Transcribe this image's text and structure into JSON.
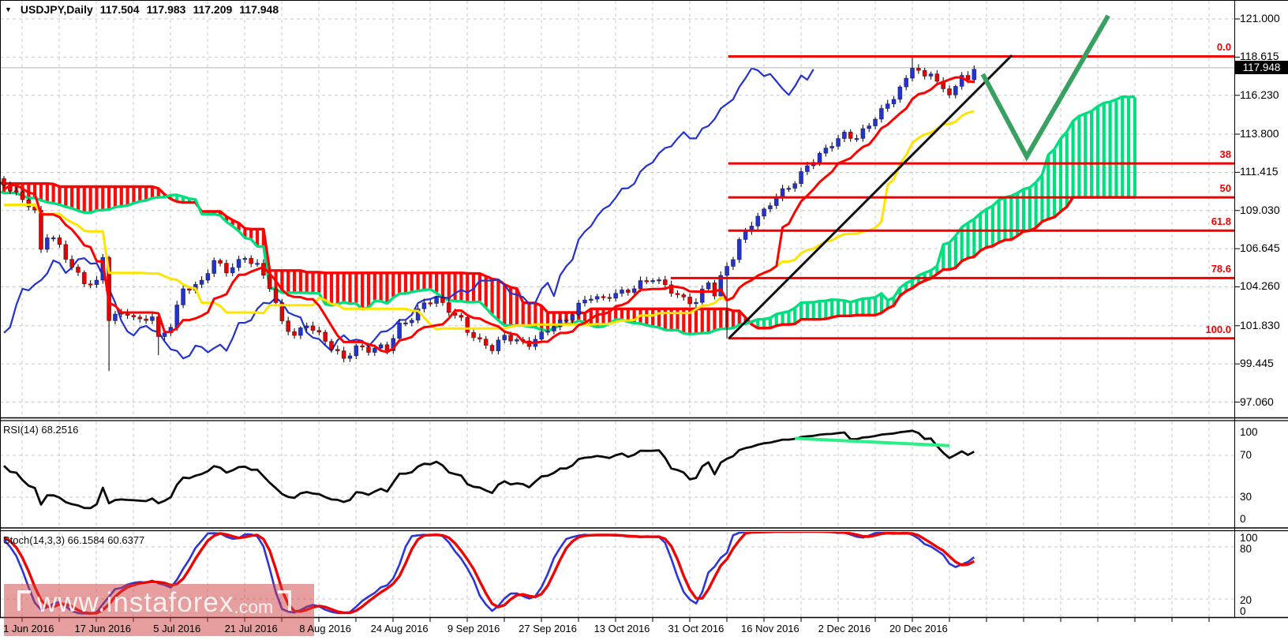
{
  "title": {
    "indicator_arrow": "▼",
    "symbol_period": "USDJPY,Daily",
    "open": "117.504",
    "high": "117.983",
    "low": "117.209",
    "close": "117.948"
  },
  "price_axis": {
    "ticks": [
      "121.000",
      "118.615",
      "116.230",
      "113.800",
      "111.415",
      "109.030",
      "106.645",
      "104.260",
      "101.830",
      "99.445",
      "97.060"
    ],
    "current_price": "117.948"
  },
  "rsi_pane": {
    "label": "RSI(14)",
    "value": "68.2516",
    "ticks": [
      "100",
      "70",
      "30",
      "0"
    ]
  },
  "stoch_pane": {
    "label": "Stoch(14,3,3)",
    "value_k": "66.1584",
    "value_d": "60.6377",
    "ticks": [
      "100",
      "80",
      "20",
      "0"
    ]
  },
  "date_axis": {
    "labels": [
      "1 Jun 2016",
      "17 Jun 2016",
      "5 Jul 2016",
      "21 Jul 2016",
      "8 Aug 2016",
      "24 Aug 2016",
      "9 Sep 2016",
      "27 Sep 2016",
      "13 Oct 2016",
      "31 Oct 2016",
      "16 Nov 2016",
      "2 Dec 2016",
      "20 Dec 2016"
    ],
    "first_index": 4,
    "index_step": 12
  },
  "watermark": {
    "text": "www.instaforex",
    "suffix": ".com"
  },
  "chart_data": {
    "type": "candlestick",
    "symbol": "USDJPY",
    "timeframe": "Daily",
    "ylim": [
      96.0,
      122.2
    ],
    "grid": true,
    "indicators": {
      "ichimoku": [
        9,
        26,
        52
      ],
      "rsi": [
        14
      ],
      "stochastic": [
        14,
        3,
        3
      ]
    },
    "current_price": 117.948,
    "close_points": [
      [
        -80,
        113.8
      ],
      [
        -75,
        112.5
      ],
      [
        -70,
        113.5
      ],
      [
        -66,
        112.0
      ],
      [
        -62,
        111.0
      ],
      [
        -58,
        112.8
      ],
      [
        -54,
        113.3
      ],
      [
        -50,
        111.5
      ],
      [
        -46,
        109.8
      ],
      [
        -42,
        108.0
      ],
      [
        -38,
        107.9
      ],
      [
        -34,
        109.5
      ],
      [
        -30,
        111.2
      ],
      [
        -26,
        110.8
      ],
      [
        -22,
        109.0
      ],
      [
        -18,
        107.6
      ],
      [
        -14,
        108.2
      ],
      [
        -10,
        109.4
      ],
      [
        -6,
        110.6
      ],
      [
        -3,
        111.1
      ],
      [
        0,
        110.6
      ],
      [
        2,
        110.1
      ],
      [
        4,
        109.5
      ],
      [
        5,
        109.0
      ],
      [
        6,
        106.5
      ],
      [
        7,
        107.4
      ],
      [
        8,
        107.2
      ],
      [
        9,
        106.7
      ],
      [
        10,
        106.1
      ],
      [
        12,
        105.1
      ],
      [
        13,
        104.6
      ],
      [
        15,
        104.5
      ],
      [
        16,
        106.0
      ],
      [
        17,
        102.2
      ],
      [
        18,
        102.4
      ],
      [
        20,
        102.7
      ],
      [
        22,
        102.2
      ],
      [
        24,
        102.4
      ],
      [
        25,
        100.9
      ],
      [
        27,
        101.8
      ],
      [
        28,
        103.0
      ],
      [
        29,
        104.2
      ],
      [
        31,
        104.4
      ],
      [
        32,
        104.6
      ],
      [
        34,
        105.8
      ],
      [
        36,
        105.2
      ],
      [
        38,
        105.9
      ],
      [
        39,
        106.2
      ],
      [
        41,
        105.6
      ],
      [
        43,
        104.2
      ],
      [
        45,
        102.0
      ],
      [
        47,
        101.3
      ],
      [
        49,
        102.0
      ],
      [
        51,
        101.2
      ],
      [
        53,
        100.4
      ],
      [
        55,
        99.8
      ],
      [
        57,
        100.6
      ],
      [
        59,
        100.3
      ],
      [
        61,
        100.4
      ],
      [
        62,
        100.3
      ],
      [
        64,
        101.9
      ],
      [
        66,
        102.4
      ],
      [
        68,
        103.2
      ],
      [
        70,
        103.4
      ],
      [
        72,
        102.8
      ],
      [
        74,
        102.3
      ],
      [
        75,
        101.6
      ],
      [
        77,
        100.8
      ],
      [
        79,
        100.3
      ],
      [
        81,
        101.2
      ],
      [
        83,
        101.0
      ],
      [
        85,
        100.7
      ],
      [
        87,
        101.2
      ],
      [
        89,
        101.8
      ],
      [
        91,
        102.3
      ],
      [
        93,
        103.2
      ],
      [
        95,
        103.6
      ],
      [
        97,
        103.4
      ],
      [
        99,
        103.9
      ],
      [
        101,
        104.1
      ],
      [
        103,
        104.5
      ],
      [
        105,
        104.7
      ],
      [
        107,
        104.3
      ],
      [
        109,
        103.8
      ],
      [
        111,
        103.4
      ],
      [
        112,
        103.3
      ],
      [
        113,
        103.9
      ],
      [
        114,
        104.5
      ],
      [
        115,
        103.7
      ],
      [
        116,
        104.8
      ],
      [
        117,
        105.6
      ],
      [
        118,
        106.2
      ],
      [
        119,
        107.2
      ],
      [
        121,
        108.2
      ],
      [
        123,
        108.9
      ],
      [
        124,
        109.4
      ],
      [
        126,
        110.3
      ],
      [
        128,
        110.9
      ],
      [
        130,
        111.8
      ],
      [
        132,
        112.4
      ],
      [
        134,
        113.2
      ],
      [
        136,
        113.9
      ],
      [
        138,
        113.6
      ],
      [
        140,
        114.3
      ],
      [
        142,
        115.2
      ],
      [
        144,
        116.2
      ],
      [
        146,
        117.3
      ],
      [
        147,
        118.1
      ],
      [
        148,
        117.7
      ],
      [
        149,
        117.2
      ],
      [
        150,
        117.6
      ],
      [
        151,
        117.1
      ],
      [
        152,
        116.5
      ],
      [
        153,
        116.4
      ],
      [
        154,
        117.0
      ],
      [
        155,
        117.4
      ],
      [
        156,
        117.2
      ],
      [
        157,
        117.95
      ]
    ],
    "wick_overrides": [
      {
        "index": 17,
        "low": 99.0
      },
      {
        "index": 25,
        "low": 99.99
      },
      {
        "index": 55,
        "low": 99.54
      },
      {
        "index": 117,
        "low": 101.04
      },
      {
        "index": 147,
        "high": 118.66
      }
    ],
    "fib_levels": [
      {
        "label": "0.0",
        "price": 118.66,
        "start_index": 117.2
      },
      {
        "label": "38",
        "price": 111.97,
        "start_index": 117.2
      },
      {
        "label": "50",
        "price": 109.85,
        "start_index": 117.2
      },
      {
        "label": "61.8",
        "price": 107.77,
        "start_index": 117.2
      },
      {
        "label": "78.6",
        "price": 104.81,
        "start_index": 107.9
      },
      {
        "label": "100.0",
        "price": 101.04,
        "start_index": 117.2
      }
    ],
    "trendline": [
      [
        117.3,
        101.04
      ],
      [
        163.1,
        118.73
      ]
    ],
    "arrow": [
      [
        158.4,
        117.55
      ],
      [
        165.5,
        112.4
      ],
      [
        178.7,
        121.2
      ]
    ],
    "rsi_trendline": [
      [
        128,
        86.3
      ],
      [
        153,
        79.2
      ]
    ],
    "colors": {
      "candle_up": "#2333cc",
      "candle_down": "#e80000",
      "wick": "#141414",
      "tenkan": "#ff0000",
      "kijun": "#ffe400",
      "chikou": "#2333cc",
      "senkou_a": "#00df7f",
      "senkou_b": "#ff0000",
      "cloud_bear": "#fb0a0a",
      "cloud_bull": "#00df7f",
      "fib": "#f00000",
      "grid": "#c9c9c9",
      "trendline": "#111111",
      "arrow": "#38a162",
      "rsi_line": "#0a0a0a",
      "rsi_trend": "#2aef86",
      "stoch_k": "#2d35d8",
      "stoch_d": "#ee0404",
      "current_price_line": "#b4b4b4"
    }
  }
}
